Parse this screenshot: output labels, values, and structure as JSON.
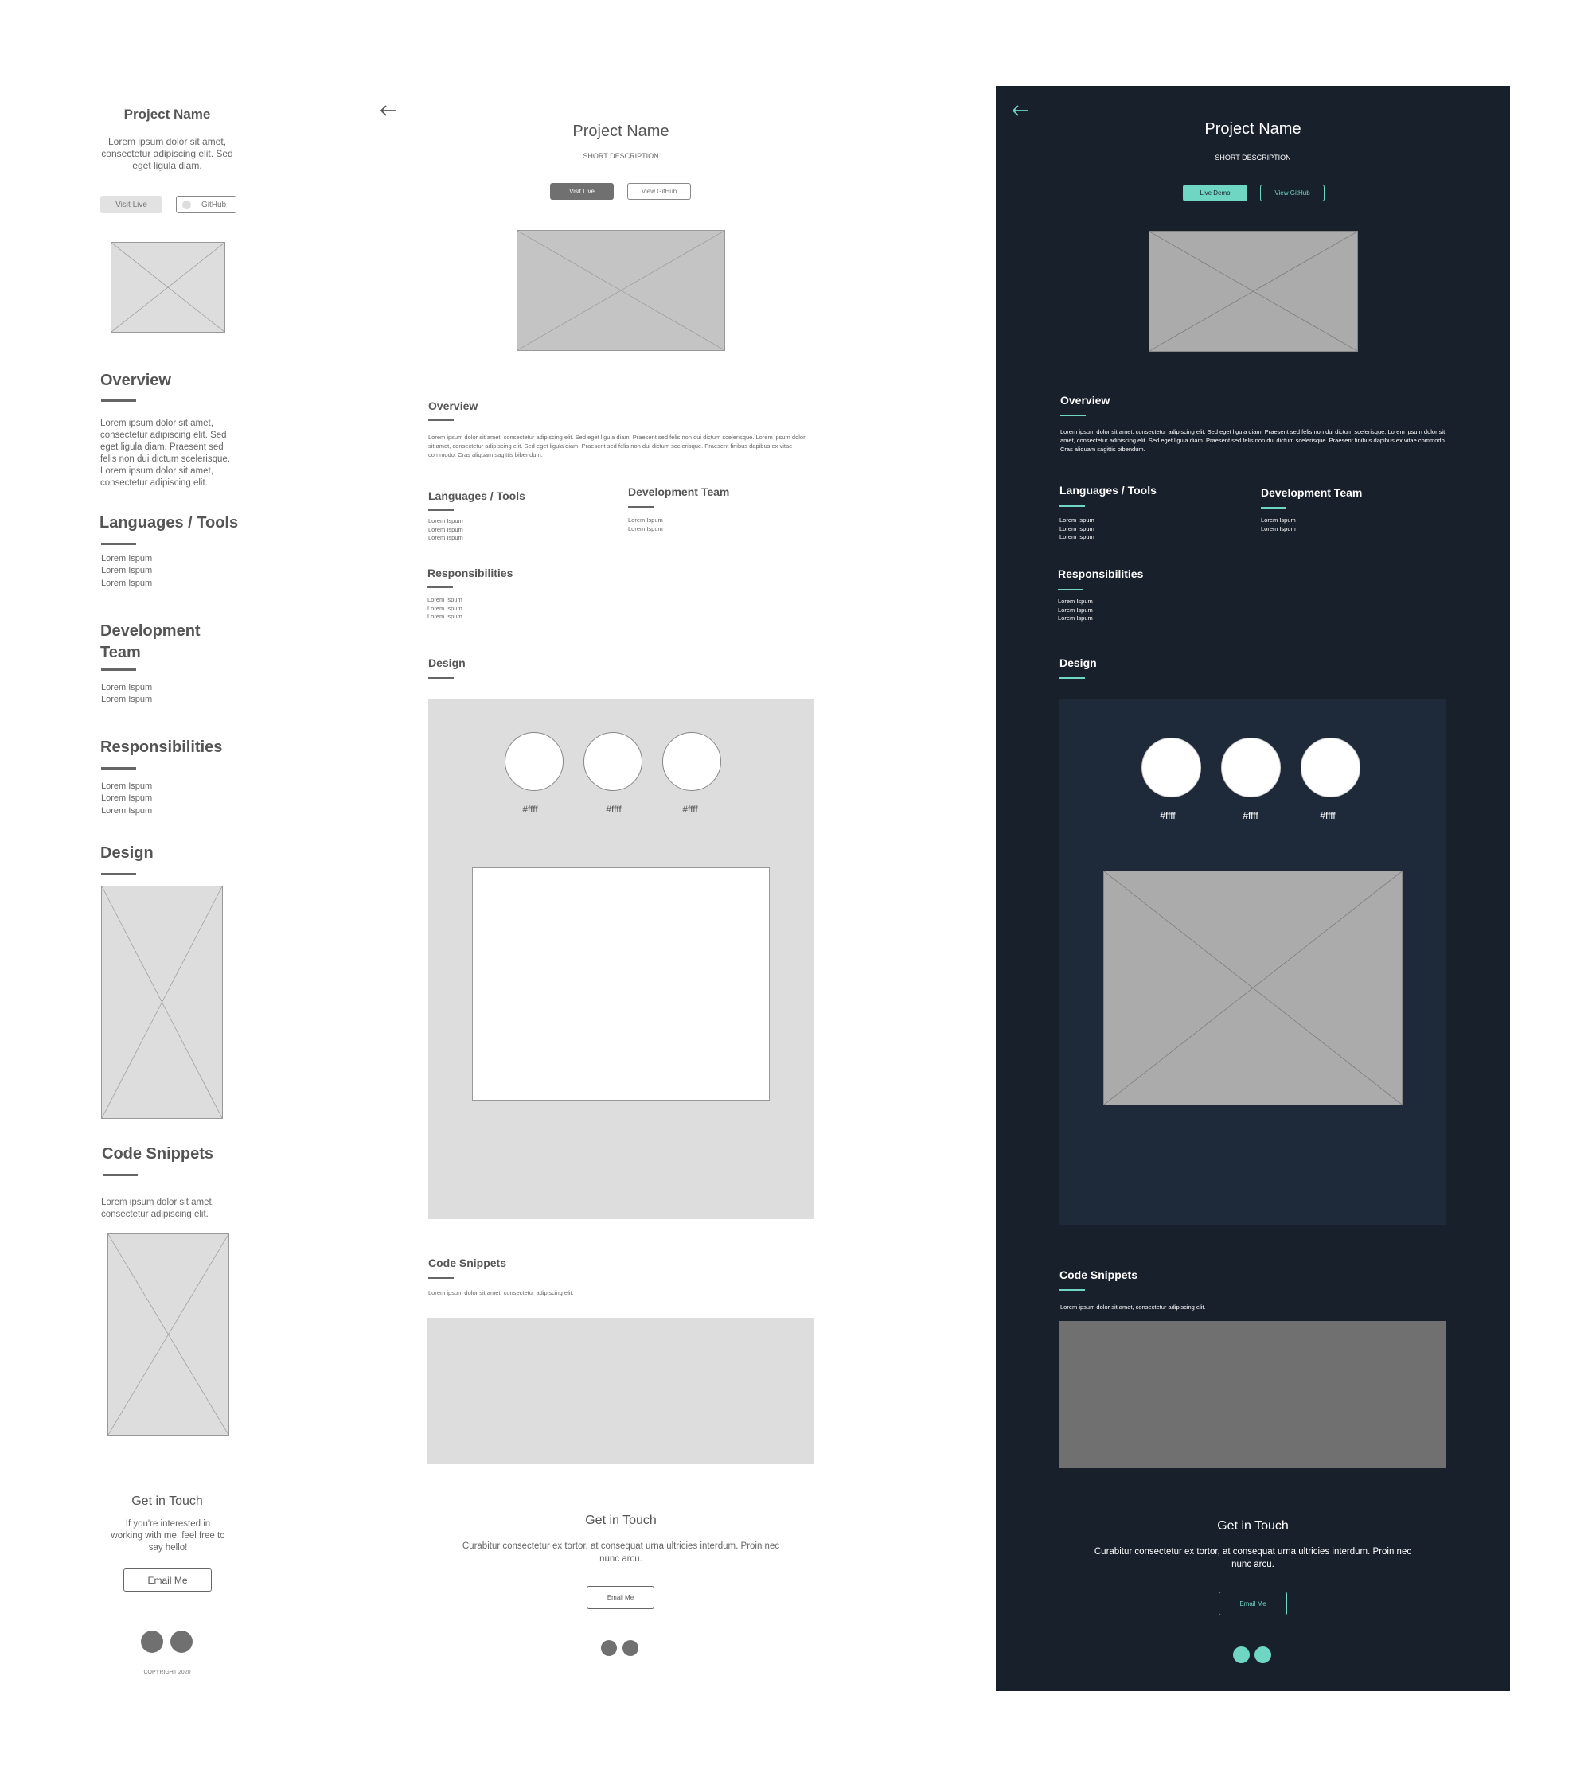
{
  "mobile": {
    "title": "Project Name",
    "description": "Lorem ipsum dolor sit amet, consectetur adipiscing elit. Sed eget ligula diam.",
    "visit_live": "Visit Live",
    "github": "GitHub",
    "overview_heading": "Overview",
    "overview_text": "Lorem ipsum dolor sit amet, consectetur adipiscing elit. Sed eget ligula diam. Praesent sed felis non dui dictum scelerisque. Lorem ipsum dolor sit amet, consectetur adipiscing elit.",
    "languages_heading": "Languages / Tools",
    "languages_items": [
      "Lorem Ispum",
      "Lorem Ispum",
      "Lorem Ispum"
    ],
    "devteam_heading": "Development Team",
    "devteam_items": [
      "Lorem Ispum",
      "Lorem Ispum"
    ],
    "responsibilities_heading": "Responsibilities",
    "responsibilities_items": [
      "Lorem Ispum",
      "Lorem Ispum",
      "Lorem Ispum"
    ],
    "design_heading": "Design",
    "code_heading": "Code Snippets",
    "code_text": "Lorem ipsum dolor sit amet, consectetur adipiscing elit.",
    "contact_heading": "Get in Touch",
    "contact_text": "If you're interested in working with me, feel free to say hello!",
    "email_button": "Email Me",
    "copyright": "COPYRIGHT 2020"
  },
  "desktop": {
    "title": "Project Name",
    "subtitle": "SHORT DESCRIPTION",
    "visit_live": "Visit Live",
    "view_github": "View GitHub",
    "overview_heading": "Overview",
    "overview_text": "Lorem ipsum dolor sit amet, consectetur adipiscing elit. Sed eget ligula diam. Praesent sed felis non dui dictum scelerisque. Lorem ipsum dolor sit amet, consectetur adipiscing elit. Sed eget ligula diam. Praesent sed felis non dui dictum scelerisque. Praesent finibus dapibus ex vitae commodo. Cras aliquam sagittis bibendum.",
    "languages_heading": "Languages / Tools",
    "languages_items": [
      "Lorem Ispum",
      "Lorem Ispum",
      "Lorem Ispum"
    ],
    "devteam_heading": "Development Team",
    "devteam_items": [
      "Lorem Ispum",
      "Lorem Ispum"
    ],
    "responsibilities_heading": "Responsibilities",
    "responsibilities_items": [
      "Lorem Ispum",
      "Lorem Ispum",
      "Lorem Ispum"
    ],
    "design_heading": "Design",
    "swatches": [
      "#ffff",
      "#ffff",
      "#ffff"
    ],
    "code_heading": "Code Snippets",
    "code_text": "Lorem ipsum dolor sit amet, consectetur adipiscing elit.",
    "contact_heading": "Get in Touch",
    "contact_text": "Curabitur consectetur ex tortor, at consequat urna ultricies interdum. Proin nec nunc arcu.",
    "email_button": "Email Me"
  },
  "dark": {
    "title": "Project Name",
    "subtitle": "SHORT DESCRIPTION",
    "live_demo": "Live Demo",
    "view_github": "View GitHub",
    "overview_heading": "Overview",
    "overview_text": "Lorem ipsum dolor sit amet, consectetur adipiscing elit. Sed eget ligula diam. Praesent sed felis non dui dictum scelerisque. Lorem ipsum dolor sit amet, consectetur adipiscing elit. Sed eget ligula diam. Praesent sed felis non dui dictum scelerisque. Praesent finibus dapibus ex vitae commodo. Cras aliquam sagittis bibendum.",
    "languages_heading": "Languages / Tools",
    "languages_items": [
      "Lorem Ispum",
      "Lorem Ispum",
      "Lorem Ispum"
    ],
    "devteam_heading": "Development Team",
    "devteam_items": [
      "Lorem Ispum",
      "Lorem Ispum"
    ],
    "responsibilities_heading": "Responsibilities",
    "responsibilities_items": [
      "Lorem Ispum",
      "Lorem Ispum",
      "Lorem Ispum"
    ],
    "design_heading": "Design",
    "swatches": [
      "#ffff",
      "#ffff",
      "#ffff"
    ],
    "code_heading": "Code Snippets",
    "code_text": "Lorem ipsum dolor sit amet, consectetur adipiscing elit.",
    "contact_heading": "Get in Touch",
    "contact_text": "Curabitur consectetur ex tortor, at consequat urna ultricies interdum. Proin nec nunc arcu.",
    "email_button": "Email Me"
  },
  "icons": {
    "back": "arrow-left-icon",
    "placeholder": "image-placeholder-icon",
    "social": "social-circle-icon"
  },
  "colors": {
    "dark_background": "#18202b",
    "dark_panel": "#1e2a3a",
    "accent": "#6fd6c4",
    "wire_gray": "#dddddd",
    "wire_text": "#555555"
  }
}
